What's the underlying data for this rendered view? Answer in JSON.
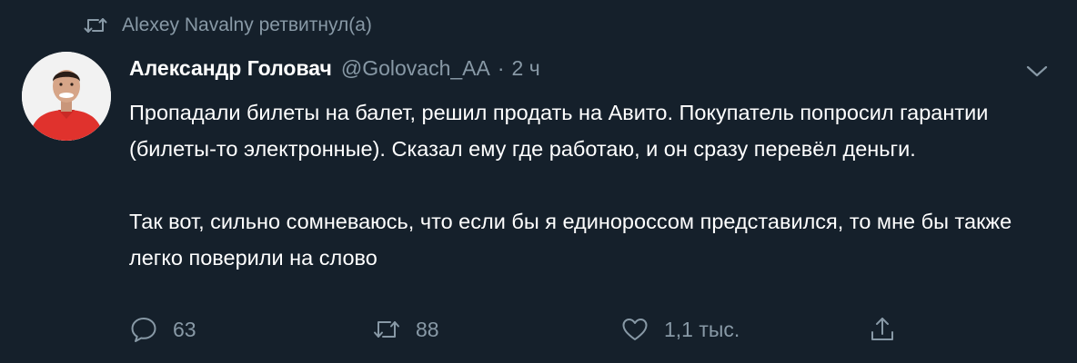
{
  "retweet_context": {
    "text": "Alexey Navalny ретвитнул(а)",
    "icon": "retweet-icon"
  },
  "author": {
    "name": "Александр Головач",
    "handle": "@Golovach_AA",
    "separator": "·",
    "time": "2 ч",
    "avatar_icon": "avatar"
  },
  "tweet": {
    "paragraph_1": "Пропадали билеты на балет, решил продать на Авито. Покупатель попросил гарантии (билеты-то электронные). Сказал ему где работаю, и он сразу перевёл деньги.",
    "paragraph_2": "Так вот, сильно сомневаюсь, что если бы я единороссом представился, то мне бы также легко поверили на слово"
  },
  "actions": {
    "reply": {
      "count": "63",
      "icon": "reply-icon"
    },
    "retweet": {
      "count": "88",
      "icon": "retweet-icon"
    },
    "like": {
      "count": "1,1 тыс.",
      "icon": "heart-icon"
    },
    "share": {
      "icon": "share-icon"
    }
  },
  "menu": {
    "icon": "chevron-down-icon"
  },
  "colors": {
    "background": "#15202b",
    "text_primary": "#ffffff",
    "text_secondary": "#8899a6",
    "avatar_shirt": "#e0322d"
  }
}
